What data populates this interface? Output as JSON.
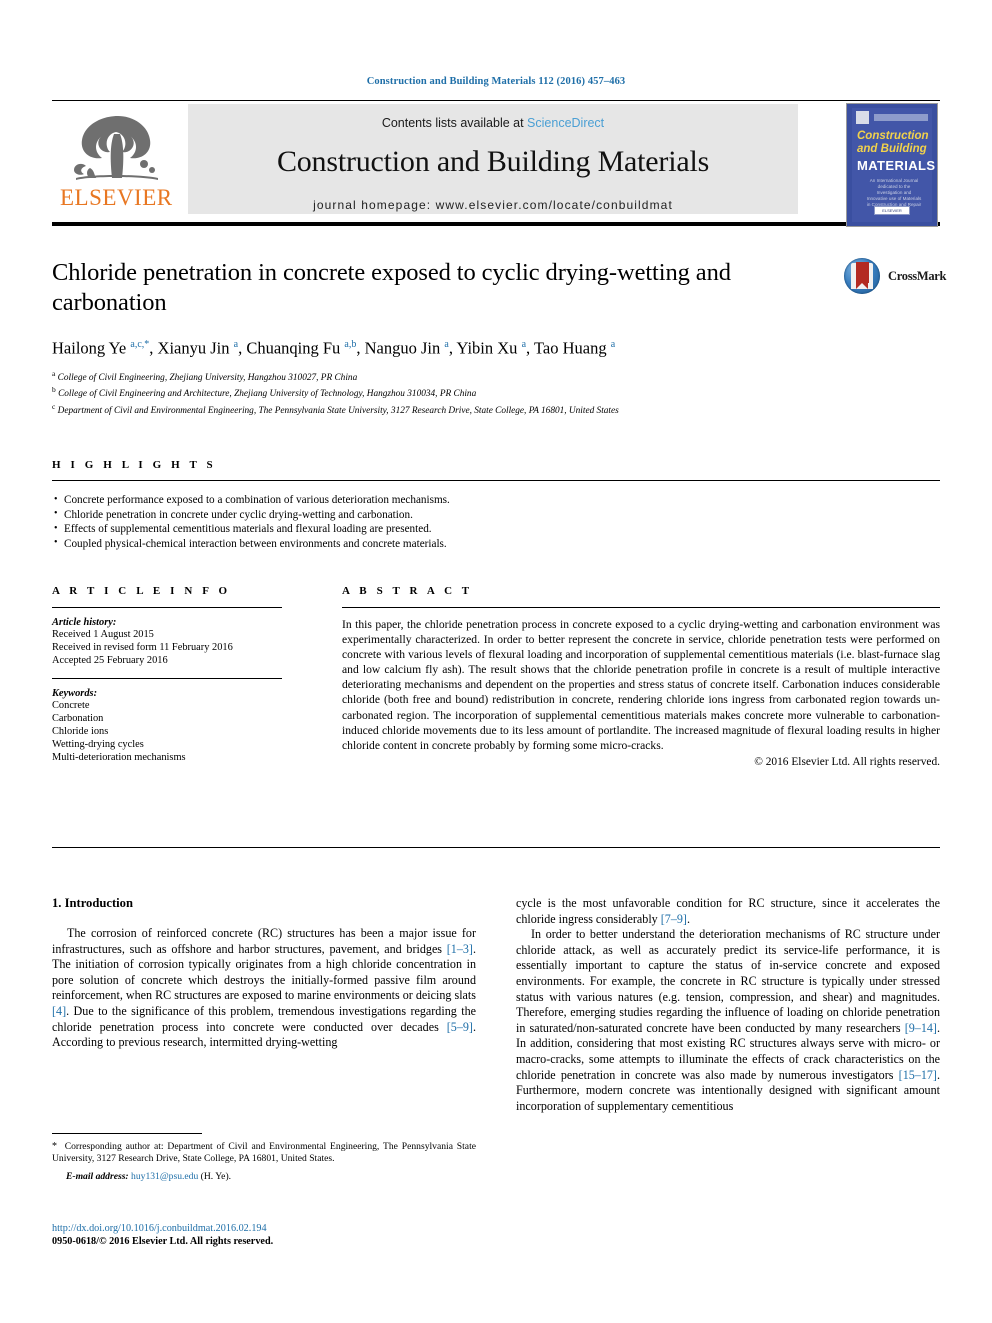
{
  "running_head": "Construction and Building Materials 112 (2016) 457–463",
  "masthead": {
    "publisher_name": "ELSEVIER",
    "contents_prefix": "Contents lists available at ",
    "sciencedirect": "ScienceDirect",
    "journal_title": "Construction and Building Materials",
    "homepage": "journal homepage: www.elsevier.com/locate/conbuildmat",
    "cover": {
      "line1": "Construction",
      "line2": "and Building",
      "line3": "MATERIALS",
      "subtitle": "An International Journal dedicated to the Investigation and Innovative use of Materials in Construction and Repair",
      "footer": "ELSEVIER"
    }
  },
  "article": {
    "title": "Chloride penetration in concrete exposed to cyclic drying-wetting and carbonation",
    "authors_html": "Hailong Ye <sup>a,c,</sup><sup>*</sup>, Xianyu Jin <sup>a</sup>, Chuanqing Fu <sup>a,b</sup>, Nanguo Jin <sup>a</sup>, Yibin Xu <sup>a</sup>, Tao Huang <sup>a</sup>",
    "affiliations": [
      {
        "marker": "a",
        "text": "College of Civil Engineering, Zhejiang University, Hangzhou 310027, PR China"
      },
      {
        "marker": "b",
        "text": "College of Civil Engineering and Architecture, Zhejiang University of Technology, Hangzhou 310034, PR China"
      },
      {
        "marker": "c",
        "text": "Department of Civil and Environmental Engineering, The Pennsylvania State University, 3127 Research Drive, State College, PA 16801, United States"
      }
    ],
    "crossmark_label": "CrossMark"
  },
  "highlights": {
    "heading": "H I G H L I G H T S",
    "items": [
      "Concrete performance exposed to a combination of various deterioration mechanisms.",
      "Chloride penetration in concrete under cyclic drying-wetting and carbonation.",
      "Effects of supplemental cementitious materials and flexural loading are presented.",
      "Coupled physical-chemical interaction between environments and concrete materials."
    ]
  },
  "article_info": {
    "heading": "A R T I C L E  I N F O",
    "history_label": "Article history:",
    "history": [
      "Received 1 August 2015",
      "Received in revised form 11 February 2016",
      "Accepted 25 February 2016"
    ],
    "keywords_label": "Keywords:",
    "keywords": [
      "Concrete",
      "Carbonation",
      "Chloride ions",
      "Wetting-drying cycles",
      "Multi-deterioration mechanisms"
    ]
  },
  "abstract": {
    "heading": "A B S T R A C T",
    "text": "In this paper, the chloride penetration process in concrete exposed to a cyclic drying-wetting and carbonation environment was experimentally characterized. In order to better represent the concrete in service, chloride penetration tests were performed on concrete with various levels of flexural loading and incorporation of supplemental cementitious materials (i.e. blast-furnace slag and low calcium fly ash). The result shows that the chloride penetration profile in concrete is a result of multiple interactive deteriorating mechanisms and dependent on the properties and stress status of concrete itself. Carbonation induces considerable chloride (both free and bound) redistribution in concrete, rendering chloride ions ingress from carbonated region towards un-carbonated region. The incorporation of supplemental cementitious materials makes concrete more vulnerable to carbonation-induced chloride movements due to its less amount of portlandite. The increased magnitude of flexural loading results in higher chloride content in concrete probably by forming some micro-cracks.",
    "copyright": "© 2016 Elsevier Ltd. All rights reserved."
  },
  "body": {
    "section_title": "1. Introduction",
    "left_paragraphs_html": [
      "The corrosion of reinforced concrete (RC) structures has been a major issue for infrastructures, such as offshore and harbor structures, pavement, and bridges <span class=\"ref\">[1–3]</span>. The initiation of corrosion typically originates from a high chloride concentration in pore solution of concrete which destroys the initially-formed passive film around reinforcement, when RC structures are exposed to marine environments or deicing slats <span class=\"ref\">[4]</span>. Due to the significance of this problem, tremendous investigations regarding the chloride penetration process into concrete were conducted over decades <span class=\"ref\">[5–9]</span>. According to previous research, intermitted drying-wetting"
    ],
    "right_paragraphs_html": [
      "cycle is the most unfavorable condition for RC structure, since it accelerates the chloride ingress considerably <span class=\"ref\">[7–9]</span>.",
      "In order to better understand the deterioration mechanisms of RC structure under chloride attack, as well as accurately predict its service-life performance, it is essentially important to capture the status of in-service concrete and exposed environments. For example, the concrete in RC structure is typically under stressed status with various natures (e.g. tension, compression, and shear) and magnitudes. Therefore, emerging studies regarding the influence of loading on chloride penetration in saturated/non-saturated concrete have been conducted by many researchers <span class=\"ref\">[9–14]</span>. In addition, considering that most existing RC structures always serve with micro- or macro-cracks, some attempts to illuminate the effects of crack characteristics on the chloride penetration in concrete was also made by numerous investigators <span class=\"ref\">[15–17]</span>. Furthermore, modern concrete was intentionally designed with significant amount incorporation of supplementary cementitious"
    ]
  },
  "footnote": {
    "corresponding_html": "<span class=\"star\">*</span>&nbsp; Corresponding author at: Department of Civil and Environmental Engineering, The Pennsylvania State University, 3127 Research Drive, State College, PA 16801, United States.",
    "email_label": "E-mail address:",
    "email": "huy131@psu.edu",
    "email_owner": "(H. Ye)."
  },
  "doi": {
    "url": "http://dx.doi.org/10.1016/j.conbuildmat.2016.02.194",
    "issn": "0950-0618/© 2016 Elsevier Ltd. All rights reserved."
  },
  "colors": {
    "link_blue": "#1f6fa8",
    "sciencedirect_blue": "#4a9fd4",
    "elsevier_orange": "#E87722",
    "cover_blue": "#4256a8",
    "cover_yellow": "#f2d24b",
    "crossmark_red": "#b32a22"
  }
}
